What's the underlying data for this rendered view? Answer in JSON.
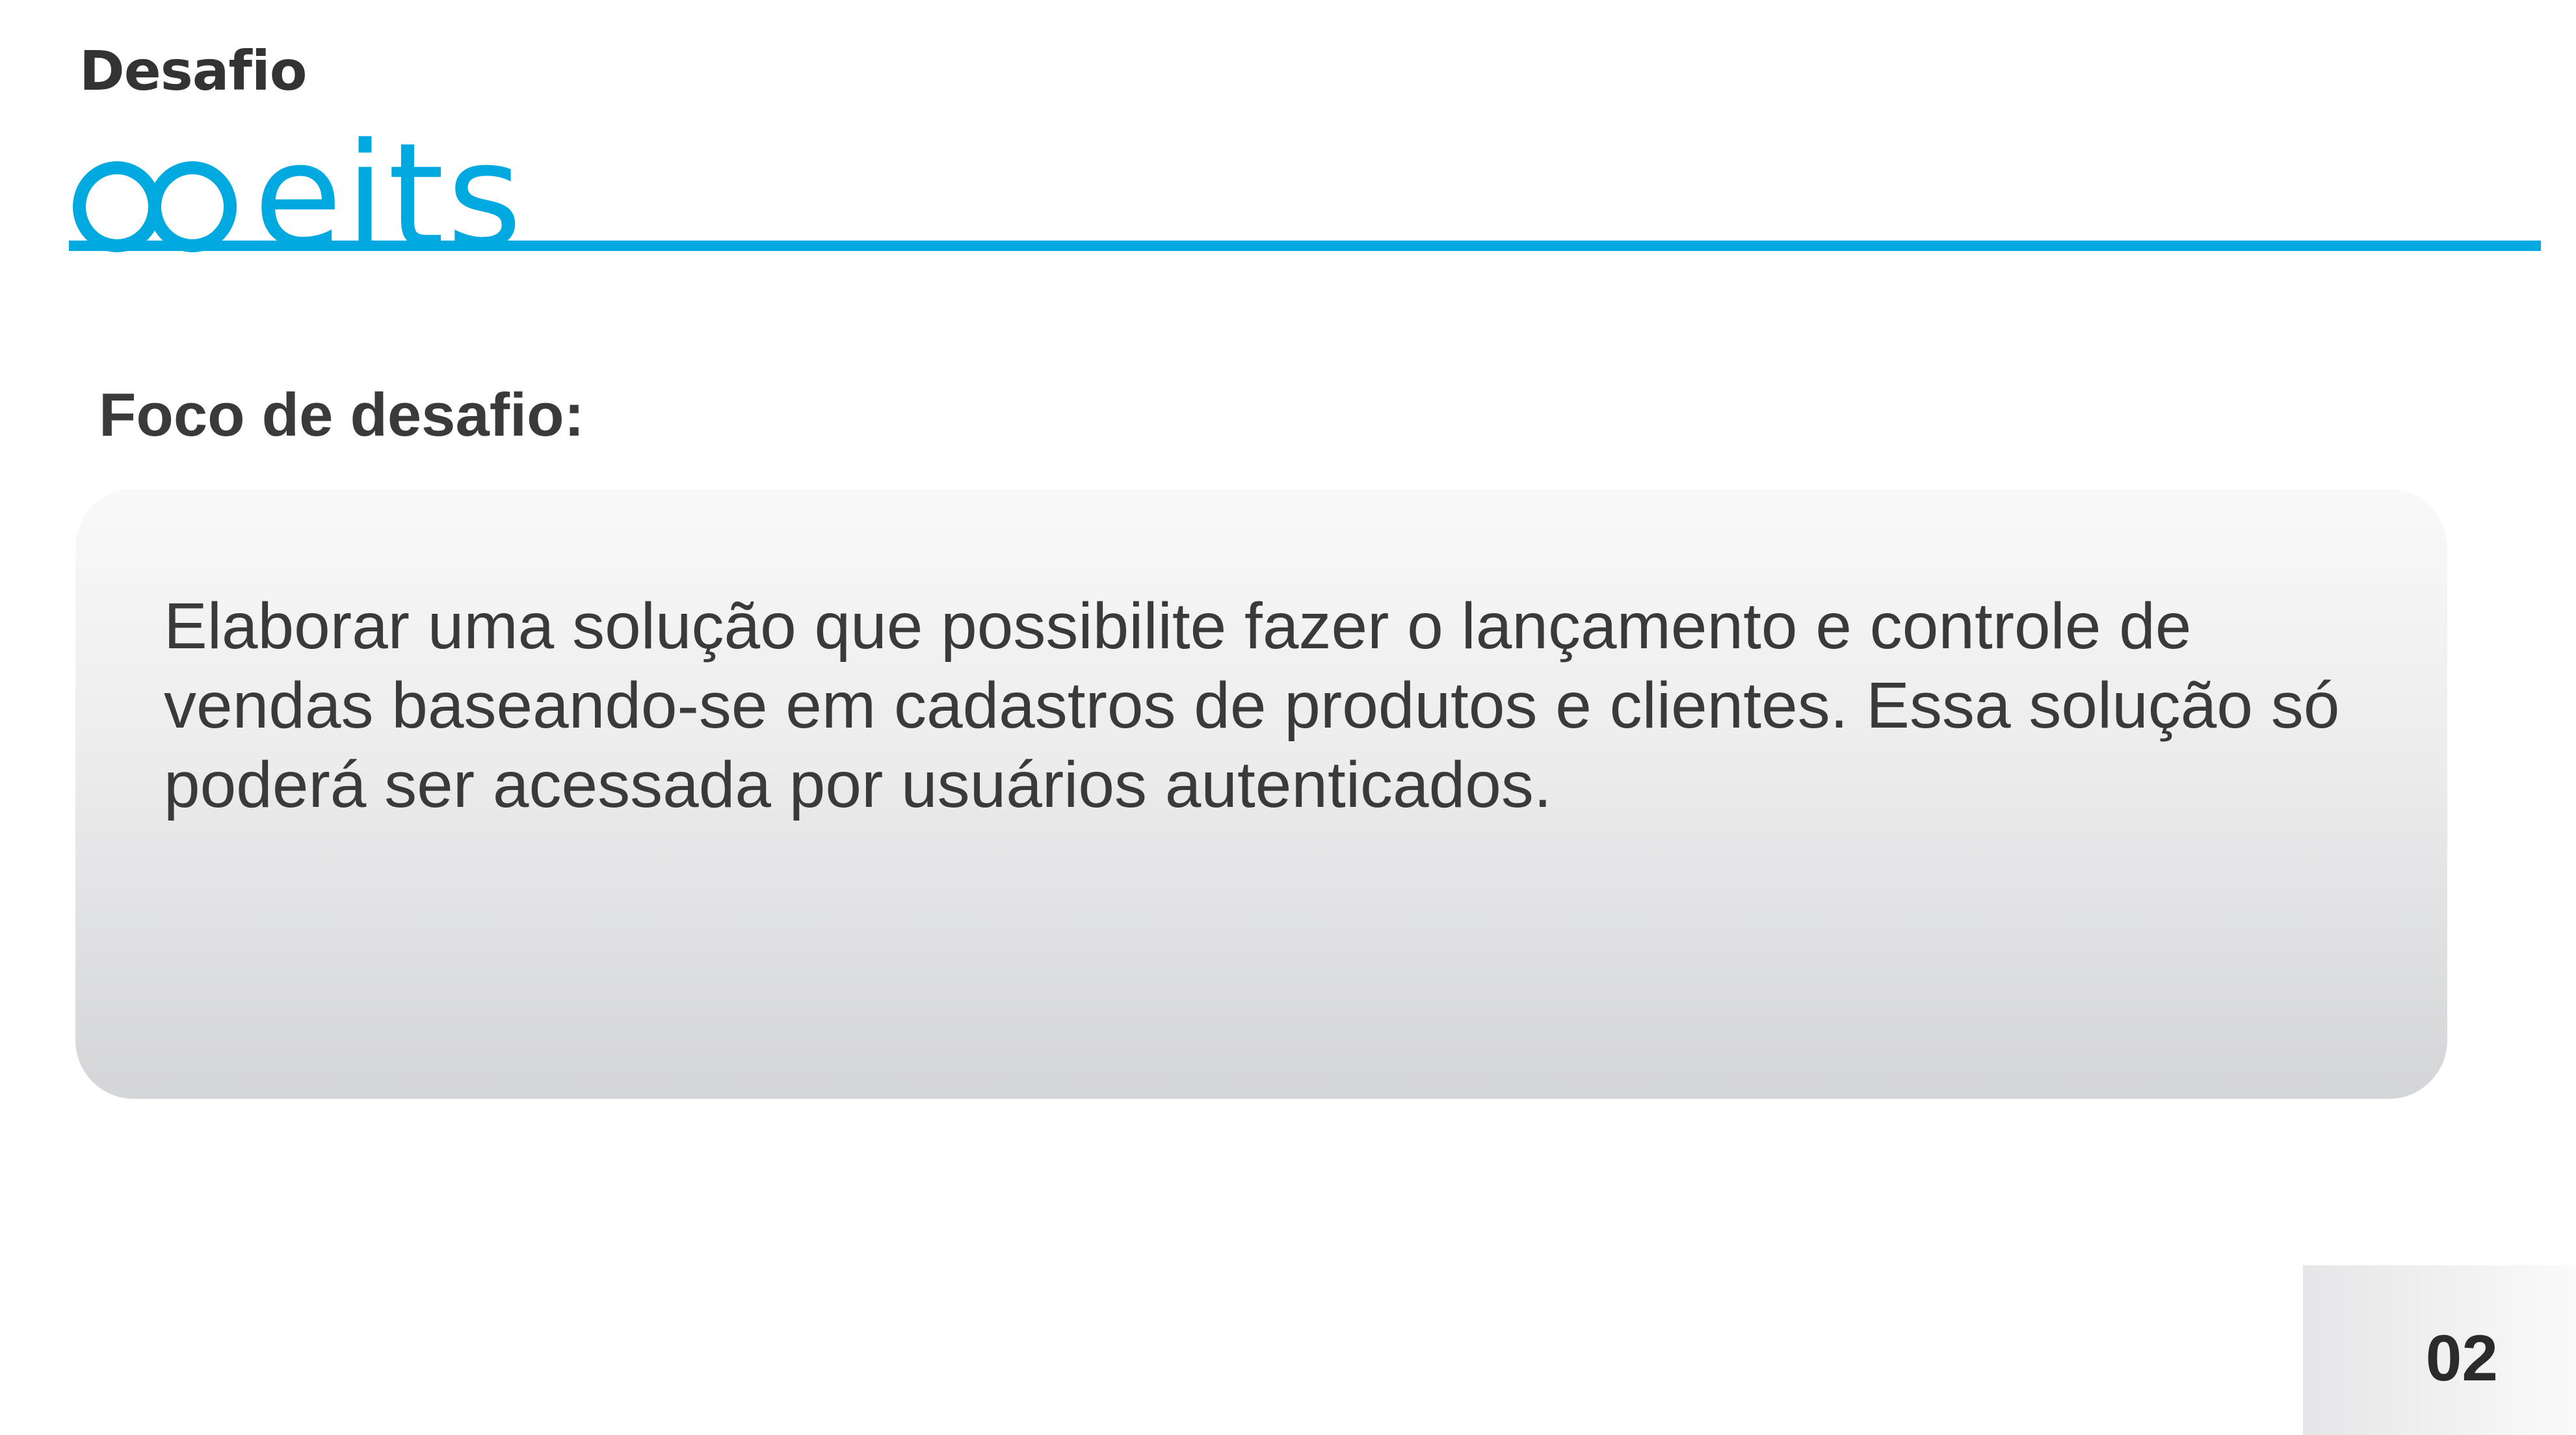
{
  "header": {
    "logo_top_text": "Desafio",
    "logo_brand_text": "eits",
    "brand_color": "#00a9e0"
  },
  "section": {
    "title": "Foco de desafio:"
  },
  "content": {
    "paragraph": "Elaborar uma solução que possibilite fazer o lançamento e controle de vendas baseando-se em cadastros de produtos e clientes. Essa solução só poderá ser acessada por usuários autenticados."
  },
  "footer": {
    "page_number": "02"
  }
}
